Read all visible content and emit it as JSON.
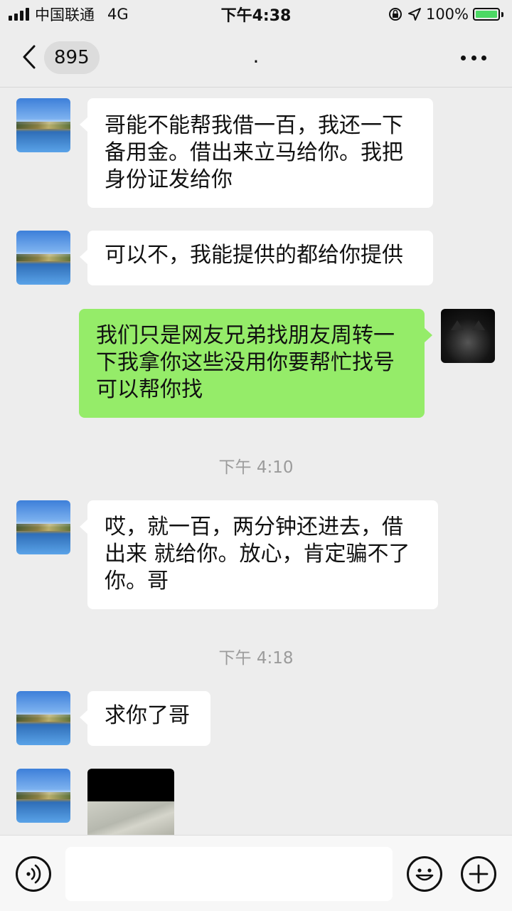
{
  "status_bar": {
    "carrier": "中国联通",
    "network": "4G",
    "time": "下午4:38",
    "battery": "100%"
  },
  "nav": {
    "unread_count": "895",
    "title": "."
  },
  "messages": [
    {
      "side": "in",
      "text": "哥能不能帮我借一百，我还一下\n备用金。借出来立马给你。我把\n身份证发给你"
    },
    {
      "side": "in",
      "text": "可以不，我能提供的都给你提供"
    },
    {
      "side": "out",
      "text": "我们只是网友兄弟找朋友周转一\n下我拿你这些没用你要帮忙找号\n可以帮你找"
    },
    {
      "time": "下午 4:10"
    },
    {
      "side": "in",
      "text": "哎，就一百，两分钟还进去，借\n出来 就给你。放心，肯定骗不了\n你。哥"
    },
    {
      "time": "下午 4:18"
    },
    {
      "side": "in",
      "text": "求你了哥"
    },
    {
      "side": "in",
      "type": "image"
    }
  ],
  "input_bar": {
    "voice_icon": "voice-icon",
    "emoji_icon": "emoji-icon",
    "add_icon": "add-icon"
  }
}
